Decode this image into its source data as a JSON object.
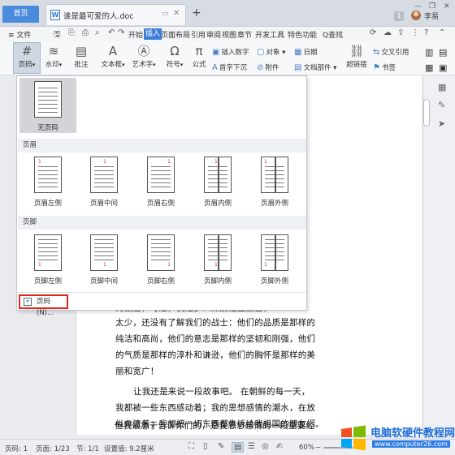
{
  "titlebar": {
    "home_tab": "首页",
    "doc_tab": "谁是最可爱的人.doc",
    "add_tab": "+",
    "badge": "1",
    "username": "李易",
    "minimize": "—",
    "restore": "❐",
    "close": "✕"
  },
  "menubar": {
    "file": "≡ 文件",
    "items": [
      "开始",
      "插入",
      "页面布局",
      "引用",
      "审阅",
      "视图",
      "章节",
      "开发工具",
      "特色功能"
    ],
    "active": "插入",
    "search": "Q查找"
  },
  "ribbon": {
    "page_number": "页码",
    "watermark": "水印",
    "comment": "批注",
    "textbox": "文本框",
    "art_text": "艺术字",
    "symbol": "符号",
    "formula": "公式",
    "insert_number": "插入数字",
    "first_drop": "首字下沉",
    "object": "对象",
    "attachment": "附件",
    "date": "日期",
    "doc_parts": "文档部件",
    "hyperlink": "超链接",
    "cross_ref": "交叉引用",
    "bookmark": "书签"
  },
  "dropdown": {
    "none_label": "无页码",
    "header_section": "页眉",
    "header_items": [
      "页眉左侧",
      "页眉中间",
      "页眉右侧",
      "页眉内侧",
      "页眉外侧"
    ],
    "footer_section": "页脚",
    "footer_items": [
      "页脚左侧",
      "页脚中间",
      "页脚右侧",
      "页脚内侧",
      "页脚外侧"
    ],
    "page_number_button": "页码(N)...",
    "sample_number": "1"
  },
  "document": {
    "line0": "的战士，可是，我是多么热爱这些战士，",
    "line1": "太少，还没有了解我们的战士：他们的品质是那样的",
    "line2": "纯洁和高尚，他们的意志是那样的坚韧和刚强，他们",
    "line3": "的气质是那样的淳朴和谦逊，他们的胸怀是那样的美",
    "line4": "丽和宽广！",
    "line5": "让我还是来说一段故事吧。  在朝鲜的每一天，",
    "line6": "我都被一些东西感动着；我的思想感情的潮水，在放",
    "line7": "纵奔流着；我想把一切东西都告诉给我祖国的朋友们。",
    "line8": "但我最急于告诉你们的，是我思想感情的一段重要经"
  },
  "statusbar": {
    "page": "页码: 1",
    "pages": "页面: 1/23",
    "section": "节: 1/1",
    "setting": "设置值: 9.2厘米",
    "zoom": "60%"
  },
  "watermark_logo": {
    "brand": "电脑软硬件教程网",
    "url": "www.computer26.com"
  },
  "colors": {
    "accent": "#3b7fd8",
    "highlight_border": "#e0281f",
    "page_number_red": "#d42b2b"
  }
}
